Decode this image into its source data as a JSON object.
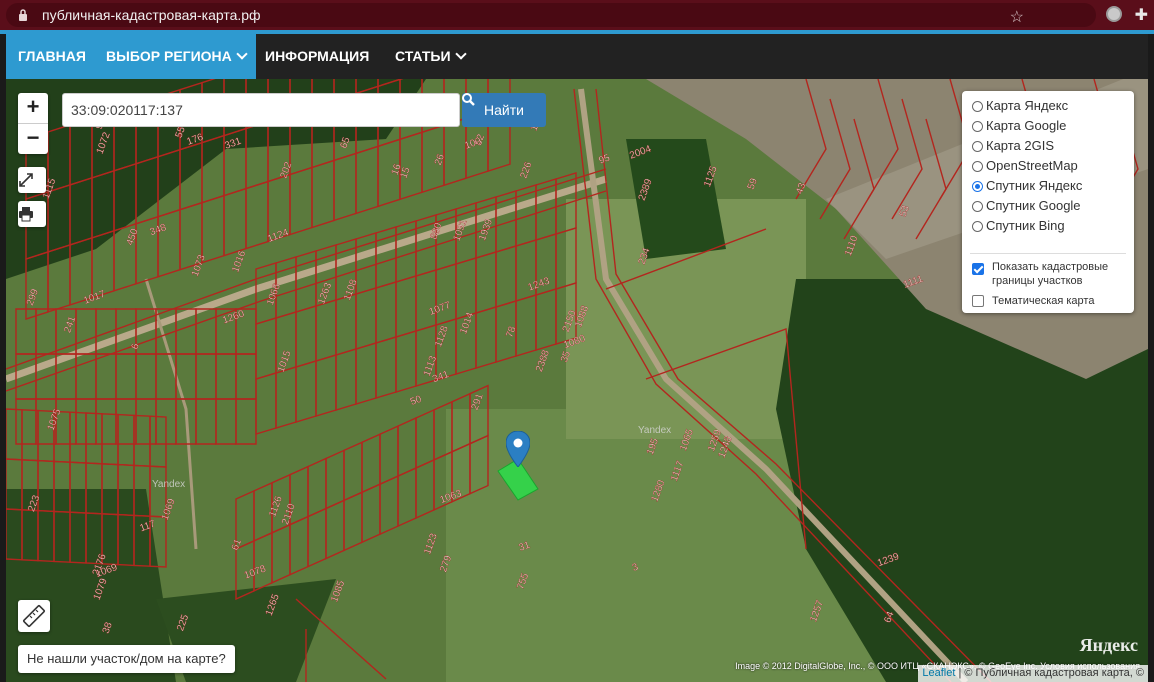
{
  "browser": {
    "url": "публичная-кадастровая-карта.рф"
  },
  "nav": {
    "items": [
      {
        "label": "ГЛАВНАЯ",
        "active": true
      },
      {
        "label": "ВЫБОР РЕГИОНА",
        "active": true
      },
      {
        "label": "ИНФОРМАЦИЯ",
        "active": false
      },
      {
        "label": "СТАТЬИ",
        "active": false
      }
    ]
  },
  "colors": {
    "accent": "#2e9ad0",
    "parcel_lines": "#c0392b",
    "selected_parcel": "#2ecc40",
    "marker": "#2b7fc3"
  },
  "map": {
    "zoom_in": "+",
    "zoom_out": "−",
    "search": {
      "value": "33:09:020117:137",
      "button": "Найти"
    },
    "layers": {
      "options": [
        {
          "label": "Карта Яндекс",
          "checked": false
        },
        {
          "label": "Карта Google",
          "checked": false
        },
        {
          "label": "Карта 2GIS",
          "checked": false
        },
        {
          "label": "OpenStreetMap",
          "checked": false
        },
        {
          "label": "Спутник Яндекс",
          "checked": true
        },
        {
          "label": "Спутник Google",
          "checked": false
        },
        {
          "label": "Спутник Bing",
          "checked": false
        }
      ],
      "show_borders": {
        "label": "Показать кадастровые границы участков",
        "checked": true
      },
      "thematic": {
        "label": "Тематическая карта",
        "checked": false
      }
    },
    "not_found_button": "Не нашли участок/дом на карте?",
    "yandex_watermarks": [
      "Yandex",
      "Yandex"
    ],
    "yandex_logo": "Яндекс",
    "imagery_attribution": "Image © 2012 DigitalGlobe, Inc., © ООО ИТЦ «СКАНЭКС», © GeoEye Inc. Условия использования",
    "leaflet_attribution": {
      "leaflet": "Leaflet",
      "rest": " | © Публичная кадастровая карта, ©"
    },
    "parcel_numbers": [
      "331",
      "202",
      "65",
      "15",
      "100",
      "226",
      "291",
      "450",
      "341",
      "2176",
      "2150",
      "2110",
      "2004",
      "1939",
      "2389",
      "2388",
      "176",
      "64",
      "6",
      "53",
      "50",
      "234",
      "225",
      "880",
      "1243",
      "1069",
      "1108",
      "1079",
      "1078",
      "1091",
      "1088",
      "1248",
      "348",
      "26",
      "241",
      "195",
      "1111",
      "1113",
      "1123",
      "1128",
      "1124",
      "1125",
      "1126",
      "1257",
      "1239",
      "1259",
      "1240",
      "1263",
      "1260",
      "1280",
      "1265",
      "299",
      "1080",
      "38",
      "279",
      "35",
      "117",
      "1110",
      "1115",
      "1117",
      "3",
      "61",
      "55",
      "96",
      "31",
      "43",
      "52",
      "1015",
      "1017",
      "1016",
      "59",
      "39",
      "95",
      "16",
      "1014",
      "223",
      "1063",
      "1085",
      "1065",
      "1066",
      "1069",
      "1072",
      "1073",
      "1075",
      "1077",
      "755",
      "78"
    ]
  },
  "icons": {
    "lock": "lock-icon",
    "star": "star-icon",
    "fullscreen": "fullscreen-icon",
    "print": "print-icon",
    "ruler": "ruler-icon",
    "marker": "map-marker-icon",
    "search": "search-icon"
  }
}
